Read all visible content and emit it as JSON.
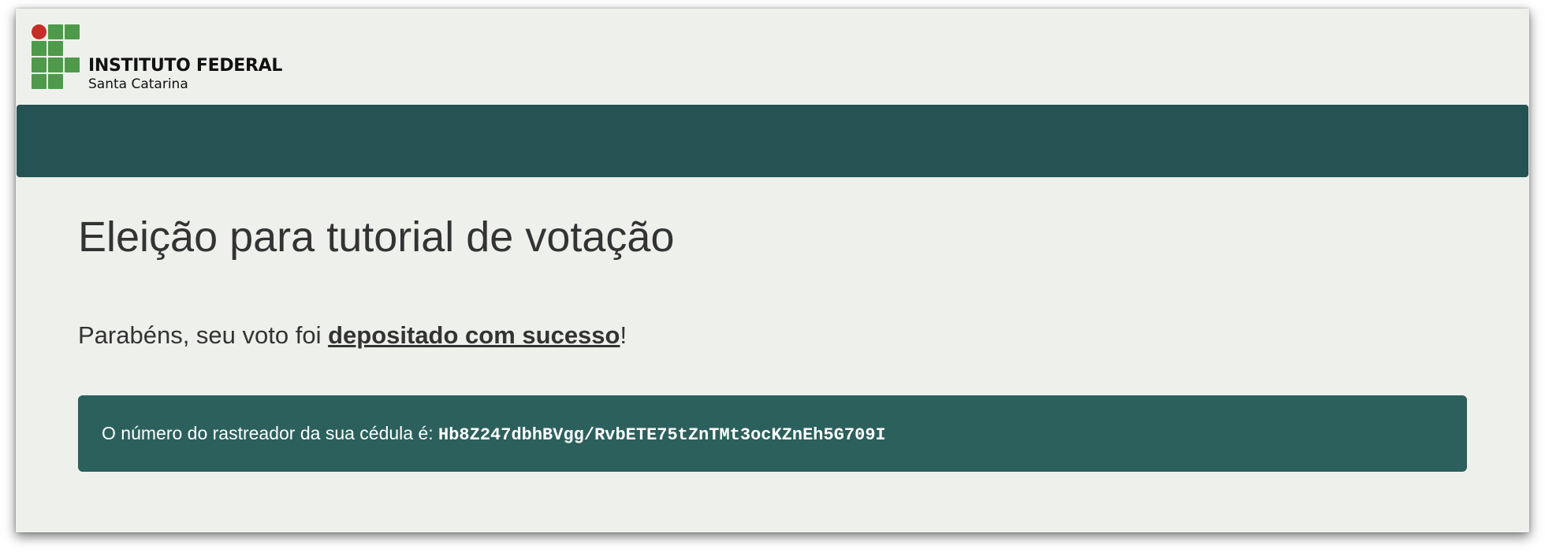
{
  "header": {
    "org_name": "INSTITUTO FEDERAL",
    "org_subtitle": "Santa Catarina",
    "logo": "ifsc-logo",
    "logo_colors": {
      "green": "#4e9a4a",
      "red": "#c62d27"
    }
  },
  "navbar": {
    "color": "#255252"
  },
  "page": {
    "title": "Eleição para tutorial de votação",
    "message_prefix": "Parabéns, seu voto foi ",
    "message_emphasis": "depositado com sucesso",
    "message_suffix": "!",
    "tracker_label": "O número do rastreador da sua cédula é: ",
    "tracker_code": "Hb8Z247dbhBVgg/RvbETE75tZnTMt3ocKZnEh5G709I",
    "tracker_bg": "#2c605c"
  }
}
